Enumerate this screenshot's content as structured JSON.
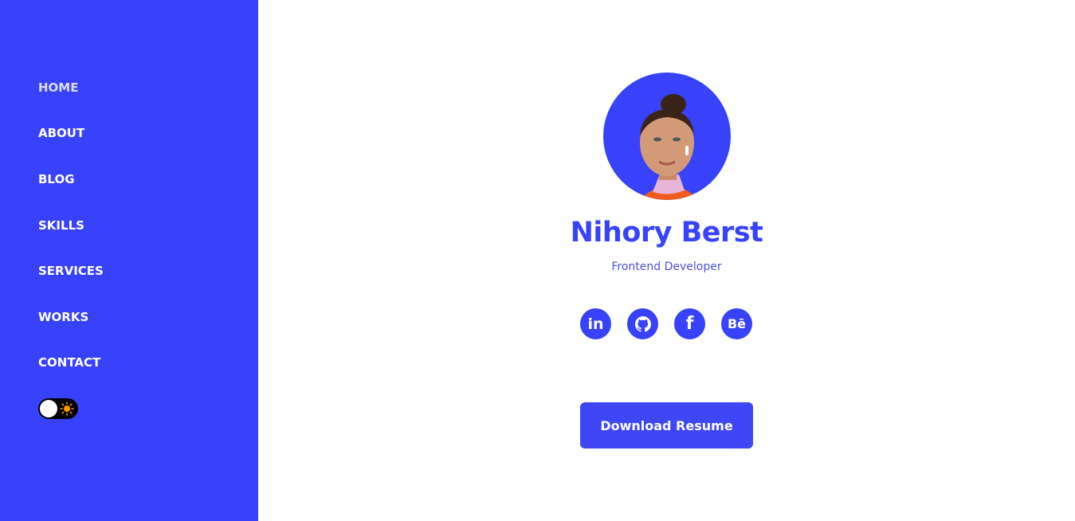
{
  "sidebar": {
    "nav": [
      {
        "label": "HOME",
        "active": true
      },
      {
        "label": "ABOUT",
        "active": false
      },
      {
        "label": "BLOG",
        "active": false
      },
      {
        "label": "SKILLS",
        "active": false
      },
      {
        "label": "SERVICES",
        "active": false
      },
      {
        "label": "WORKS",
        "active": false
      },
      {
        "label": "CONTACT",
        "active": false
      }
    ],
    "theme_toggle": {
      "state": "light",
      "icon": "sun-icon"
    }
  },
  "profile": {
    "name": "Nihory Berst",
    "role": "Frontend Developer",
    "socials": [
      {
        "name": "linkedin",
        "glyph": "in"
      },
      {
        "name": "github",
        "glyph": ""
      },
      {
        "name": "facebook",
        "glyph": "f"
      },
      {
        "name": "behance",
        "glyph": "Bē"
      }
    ],
    "download_label": "Download Resume"
  },
  "colors": {
    "accent": "#3742fa",
    "active_nav": "#dcdcf5",
    "toggle_sun": "#ff9800"
  }
}
